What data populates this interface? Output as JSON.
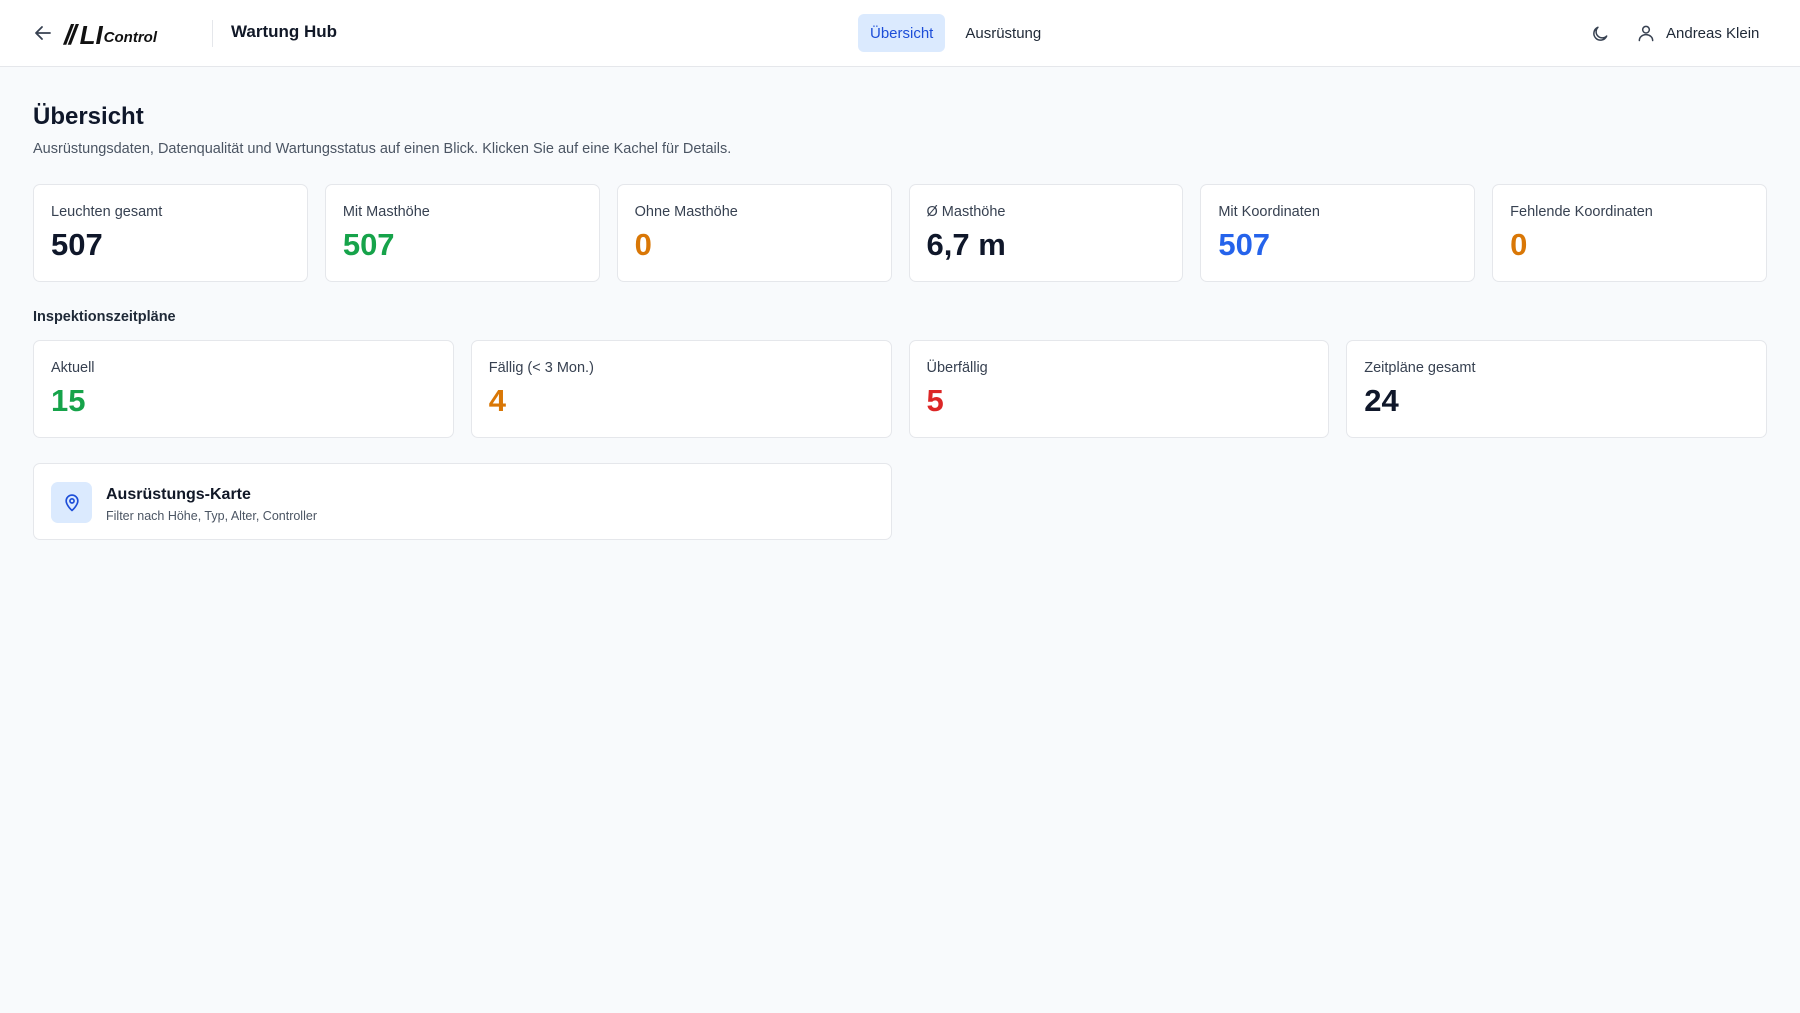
{
  "header": {
    "logo": {
      "mark": "LI",
      "suffix": "Control"
    },
    "hub_title": "Wartung Hub",
    "tabs": [
      {
        "label": "Übersicht",
        "active": true
      },
      {
        "label": "Ausrüstung",
        "active": false
      }
    ],
    "user_name": "Andreas Klein",
    "icons": {
      "back": "arrow-left-icon",
      "theme": "moon-icon",
      "user": "user-icon"
    }
  },
  "page": {
    "title": "Übersicht",
    "subtitle": "Ausrüstungsdaten, Datenqualität und Wartungsstatus auf einen Blick. Klicken Sie auf eine Kachel für Details."
  },
  "equipment_stats": [
    {
      "label": "Leuchten gesamt",
      "value": "507",
      "color": "#0f172a"
    },
    {
      "label": "Mit Masthöhe",
      "value": "507",
      "color": "#16a34a"
    },
    {
      "label": "Ohne Masthöhe",
      "value": "0",
      "color": "#d97706"
    },
    {
      "label": "Ø Masthöhe",
      "value": "6,7 m",
      "color": "#0f172a"
    },
    {
      "label": "Mit Koordinaten",
      "value": "507",
      "color": "#2563eb"
    },
    {
      "label": "Fehlende Koordinaten",
      "value": "0",
      "color": "#d97706"
    }
  ],
  "inspection": {
    "section_label": "Inspektionszeitpläne",
    "stats": [
      {
        "label": "Aktuell",
        "value": "15",
        "color": "#16a34a"
      },
      {
        "label": "Fällig (< 3 Mon.)",
        "value": "4",
        "color": "#d97706"
      },
      {
        "label": "Überfällig",
        "value": "5",
        "color": "#dc2626"
      },
      {
        "label": "Zeitpläne gesamt",
        "value": "24",
        "color": "#0f172a"
      }
    ]
  },
  "map_card": {
    "title": "Ausrüstungs-Karte",
    "subtitle": "Filter nach Höhe, Typ, Alter, Controller",
    "icon": "map-pin-icon",
    "accent": "#1d4ed8"
  }
}
